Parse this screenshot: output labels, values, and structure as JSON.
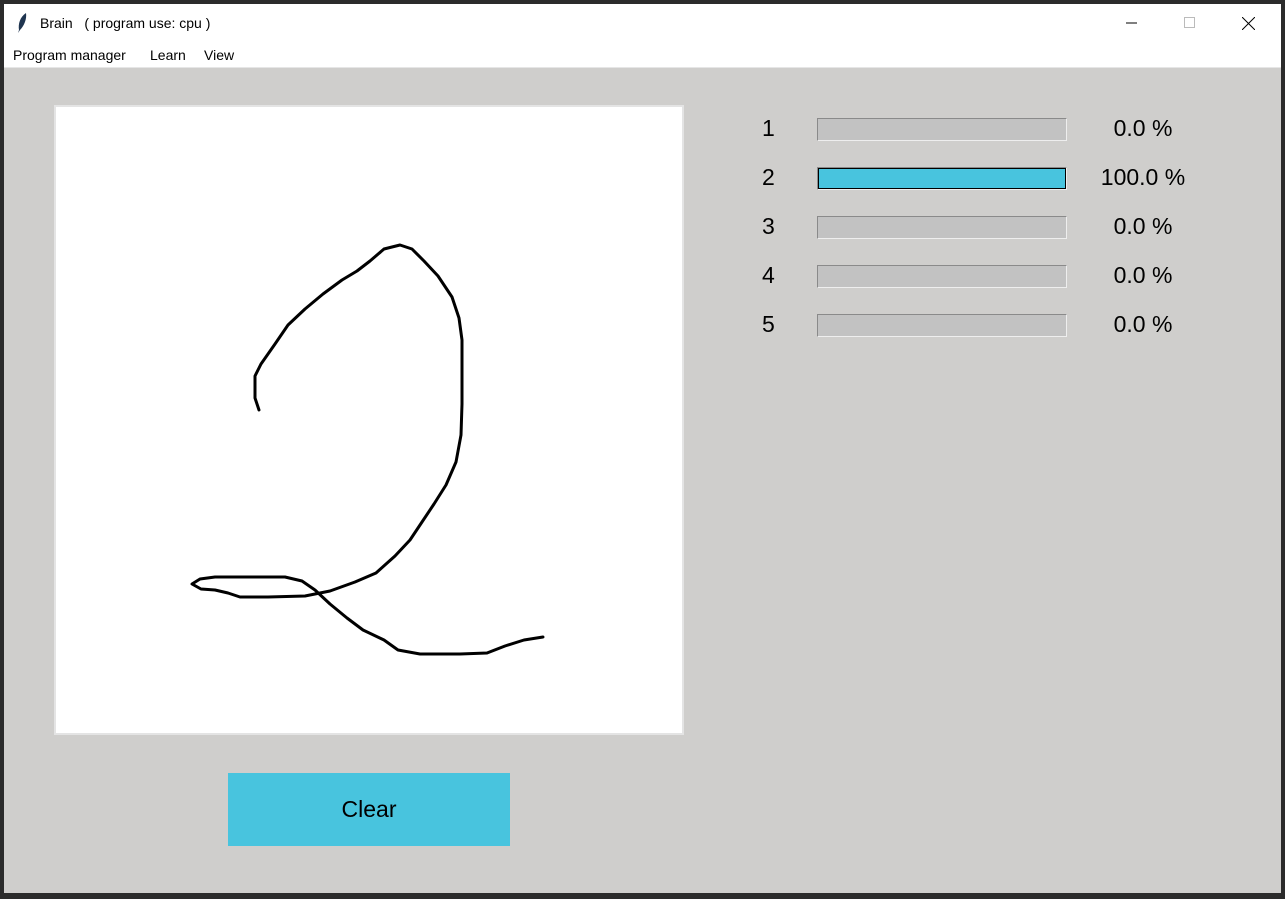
{
  "window": {
    "title": "Brain   ( program use: cpu )"
  },
  "menu": [
    "Program manager",
    "Learn",
    "View"
  ],
  "clear_label": "Clear",
  "predictions": [
    {
      "label": "1",
      "percent_text": "0.0 %",
      "value": 0.0
    },
    {
      "label": "2",
      "percent_text": "100.0 %",
      "value": 100.0
    },
    {
      "label": "3",
      "percent_text": "0.0 %",
      "value": 0.0
    },
    {
      "label": "4",
      "percent_text": "0.0 %",
      "value": 0.0
    },
    {
      "label": "5",
      "percent_text": "0.0 %",
      "value": 0.0
    }
  ],
  "colors": {
    "accent": "#48c4de",
    "background": "#cfcecc"
  }
}
